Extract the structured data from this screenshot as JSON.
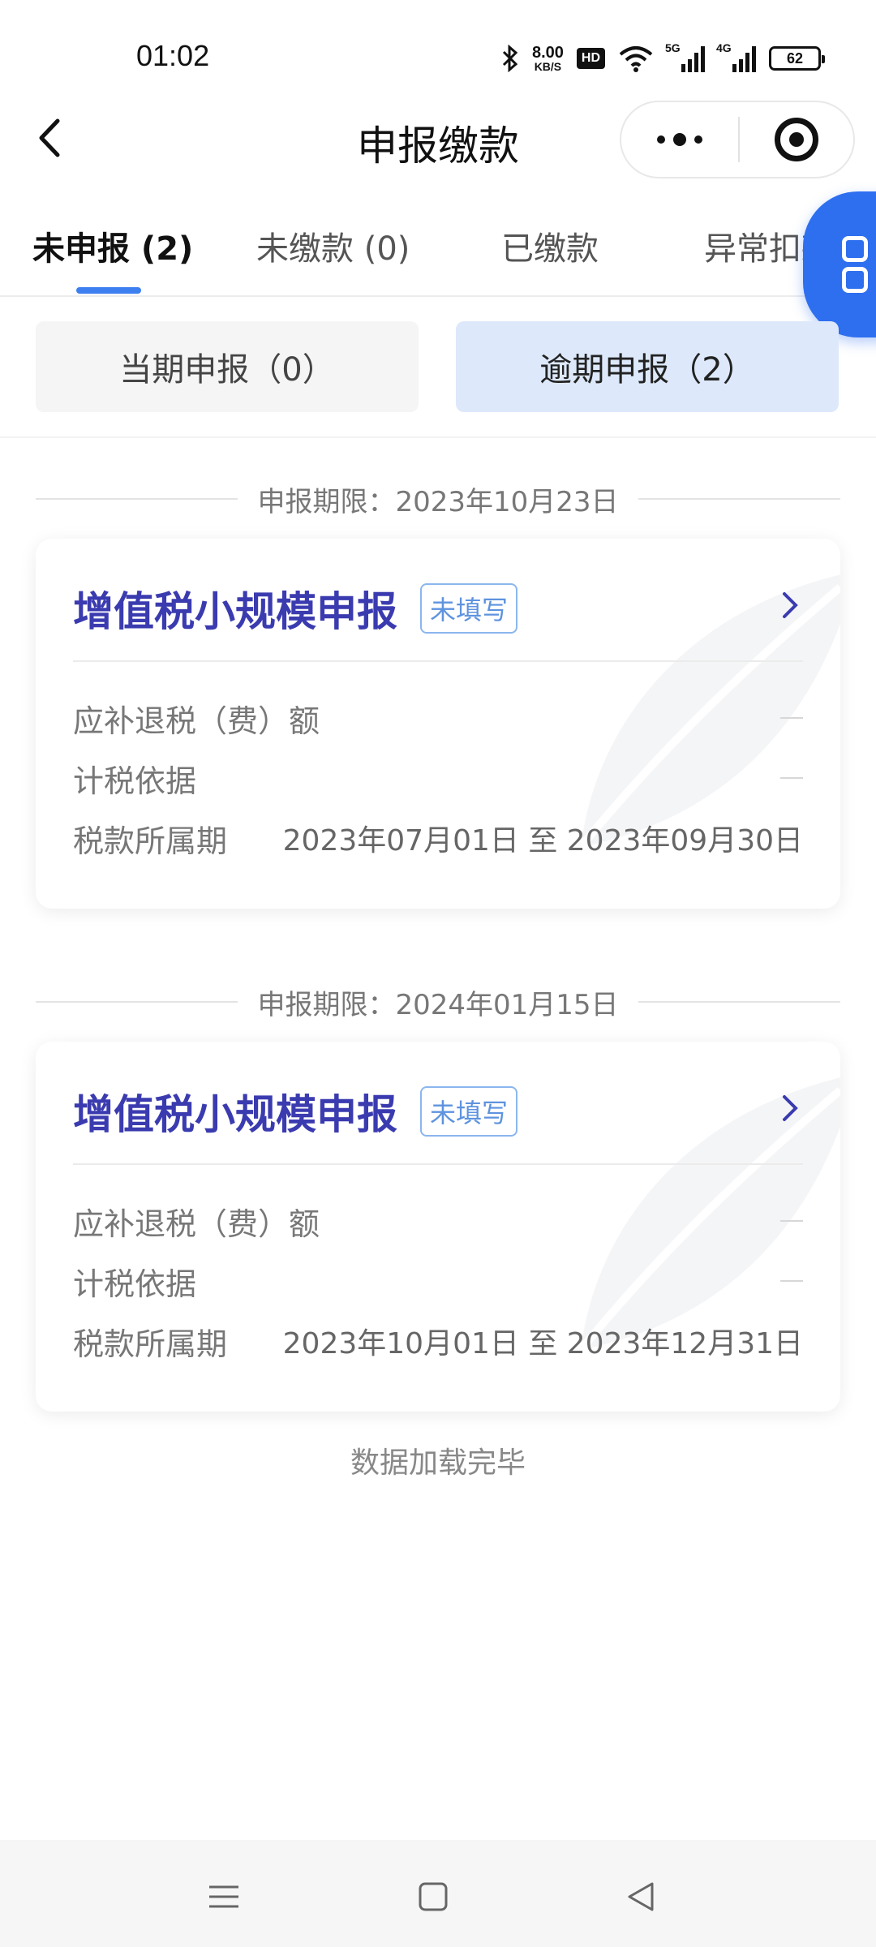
{
  "status_bar": {
    "time": "01:02",
    "net_speed_value": "8.00",
    "net_speed_unit": "KB/S",
    "hd_label": "HD",
    "sig1_label": "5G",
    "sig2_label": "4G",
    "battery": "62"
  },
  "header": {
    "title": "申报缴款"
  },
  "tabs": [
    {
      "label": "未申报 (2)",
      "active": true
    },
    {
      "label": "未缴款 (0)",
      "active": false
    },
    {
      "label": "已缴款",
      "active": false
    },
    {
      "label": "异常扣款",
      "active": false
    }
  ],
  "segment": {
    "current_label": "当期申报（0）",
    "overdue_label": "逾期申报（2）"
  },
  "groups": [
    {
      "deadline": "申报期限：2023年10月23日",
      "card": {
        "title": "增值税小规模申报",
        "badge": "未填写",
        "rows": [
          {
            "label": "应补退税（费）额",
            "value": ""
          },
          {
            "label": "计税依据",
            "value": ""
          },
          {
            "label": "税款所属期",
            "value": "2023年07月01日 至 2023年09月30日"
          }
        ]
      }
    },
    {
      "deadline": "申报期限：2024年01月15日",
      "card": {
        "title": "增值税小规模申报",
        "badge": "未填写",
        "rows": [
          {
            "label": "应补退税（费）额",
            "value": ""
          },
          {
            "label": "计税依据",
            "value": ""
          },
          {
            "label": "税款所属期",
            "value": "2023年10月01日 至 2023年12月31日"
          }
        ]
      }
    }
  ],
  "footer_note": "数据加载完毕",
  "colors": {
    "accent_blue": "#2e6ff0",
    "title_indigo": "#3b3bb0",
    "badge_blue": "#5e93df",
    "segment_active_bg": "#dde9fa"
  },
  "icons": [
    "back-arrow-icon",
    "more-dots-icon",
    "target-icon",
    "app-grid-icon",
    "chevron-right-icon",
    "leaf-watermark-icon",
    "menu-icon",
    "home-icon",
    "back-triangle-icon"
  ]
}
